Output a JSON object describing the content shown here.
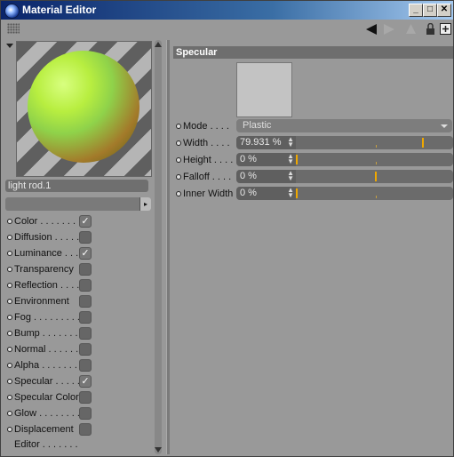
{
  "window": {
    "title": "Material Editor"
  },
  "titlebar_buttons": {
    "minimize": "_",
    "maximize": "□",
    "close": "✕"
  },
  "toolbar": {
    "icons": [
      "grip-icon",
      "back-arrow-icon",
      "forward-arrow-icon",
      "up-arrow-icon",
      "lock-icon",
      "new-window-icon"
    ]
  },
  "material": {
    "name": "light rod.1"
  },
  "channels": [
    {
      "label": "Color . . . . . . . .",
      "checked": true
    },
    {
      "label": "Diffusion . . . . .",
      "checked": false
    },
    {
      "label": "Luminance . . .",
      "checked": true
    },
    {
      "label": "Transparency",
      "checked": false
    },
    {
      "label": "Reflection . . . .",
      "checked": false
    },
    {
      "label": "Environment",
      "checked": false
    },
    {
      "label": "Fog . . . . . . . . .",
      "checked": false
    },
    {
      "label": "Bump . . . . . . .",
      "checked": false
    },
    {
      "label": "Normal . . . . . .",
      "checked": false
    },
    {
      "label": "Alpha . . . . . . .",
      "checked": false
    },
    {
      "label": "Specular . . . . .",
      "checked": true
    },
    {
      "label": "Specular Color",
      "checked": false
    },
    {
      "label": "Glow . . . . . . . .",
      "checked": false
    },
    {
      "label": "Displacement",
      "checked": false
    }
  ],
  "editor_label": "Editor . . . . . . .",
  "specular": {
    "header": "Specular",
    "params": [
      {
        "label": "Mode . . . .",
        "type": "dropdown",
        "value": "Plastic"
      },
      {
        "label": "Width . . . .",
        "type": "slider",
        "value": "79.931 %",
        "fraction": 0.8
      },
      {
        "label": "Height . . . .",
        "type": "slider",
        "value": "0 %",
        "fraction": 0.0
      },
      {
        "label": "Falloff . . . .",
        "type": "slider",
        "value": "0 %",
        "fraction": 0.5
      },
      {
        "label": "Inner Width",
        "type": "slider",
        "value": "0 %",
        "fraction": 0.0
      }
    ]
  },
  "colors": {
    "accent": "#f0a800",
    "titlebar": "#0a246a",
    "swatch": "#c3c3c3"
  }
}
